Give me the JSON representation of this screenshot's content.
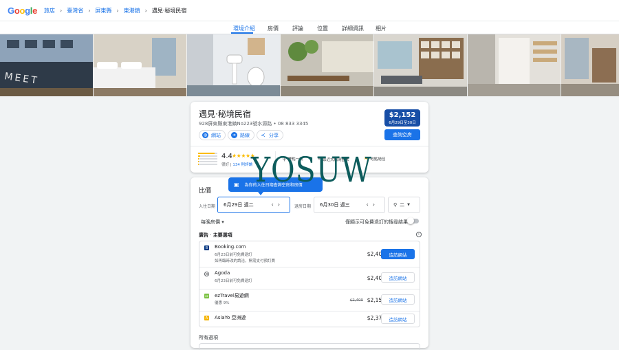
{
  "brand": {
    "logo_letters": [
      "G",
      "o",
      "o",
      "g",
      "l",
      "e"
    ]
  },
  "breadcrumb": [
    {
      "label": "旅店"
    },
    {
      "label": "臺灣省"
    },
    {
      "label": "屏東縣"
    },
    {
      "label": "東港鎮"
    },
    {
      "label": "遇見·秘境民宿"
    }
  ],
  "tabs": [
    {
      "label": "環境介紹",
      "active": true
    },
    {
      "label": "房價"
    },
    {
      "label": "評論"
    },
    {
      "label": "位置"
    },
    {
      "label": "詳細資訊"
    },
    {
      "label": "相片"
    }
  ],
  "hotel": {
    "name": "遇見·秘境民宿",
    "address": "928屏東縣東港鎮No223號水源路 • 08 833 3345",
    "actions": [
      {
        "label": "網站",
        "icon": "globe-icon"
      },
      {
        "label": "路線",
        "icon": "directions-icon"
      },
      {
        "label": "分享",
        "icon": "share-icon"
      }
    ],
    "price": "$2,152",
    "price_dates": "6月29日至30日",
    "availability_button": "查詢空房",
    "rating": {
      "score": "4.4",
      "stars": "★★★★★",
      "label": "很好",
      "reviews": "134 則評論",
      "distribution": [
        0.85,
        0.1,
        0.03,
        0.01,
        0.02
      ]
    },
    "amenities": [
      {
        "label": "餐點一流",
        "icon": "fork-icon"
      },
      {
        "label": "靠近大鵬灣國家",
        "icon": "pin-icon"
      },
      {
        "label": "地點絕佳",
        "icon": "flag-icon"
      }
    ]
  },
  "pricing": {
    "title": "比價",
    "tooltip": "為你的入住日期查詢空房和房價",
    "checkin_label": "入住日期",
    "checkin_value": "6月29日 週二",
    "checkout_label": "退房日期",
    "checkout_value": "6月30日 週三",
    "guests": "二",
    "per_night": "每晚房價 ▾",
    "free_cancel_label": "僅顯示可免費退訂的搜尋結果",
    "ads_label": "廣告",
    "ads_title": "主要選項",
    "offers": [
      {
        "name": "Booking.com",
        "logo": "B",
        "logo_color": "#003580",
        "notes": [
          "6月23日前可免費退訂",
          "如再臨時改約請洽，無需支付預訂費"
        ],
        "price": "$2,400",
        "button": "造訪網站",
        "primary": true
      },
      {
        "name": "Agoda",
        "logo": "o",
        "logo_color": "#ffffff",
        "notes": [
          "6月23日前可免費退訂"
        ],
        "price": "$2,400",
        "button": "造訪網站"
      },
      {
        "name": "ezTravel易遊網",
        "logo": "ez",
        "logo_color": "#7cc243",
        "notes": [
          "優惠 9%"
        ],
        "old_price": "$2,400",
        "price": "$2,152",
        "button": "造訪網站"
      },
      {
        "name": "AsiaYo 亞洲遊",
        "logo": "A",
        "logo_color": "#f5b400",
        "notes": [],
        "price": "$2,376",
        "button": "造訪網站"
      }
    ],
    "all_options": "所有選項"
  },
  "watermark": "YOSUW",
  "colors": {
    "accent": "#1a73e8",
    "price_box": "#174ea6",
    "star": "#fbbc04"
  }
}
